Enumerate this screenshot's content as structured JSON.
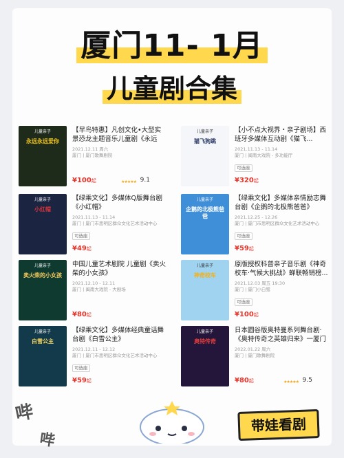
{
  "header": {
    "title_line1": "厦门11- 1月",
    "title_line2": "儿童剧合集"
  },
  "items": [
    {
      "title": "【早鸟特惠】凡创文化•大型实景恐龙主题音乐儿童剧《永远永...",
      "date": "2021.12.11 周六",
      "venue": "厦门 | 厦门歌舞剧院",
      "badge": "",
      "price": "¥100",
      "unit": "起",
      "rating": "9.1",
      "stars": "★★★★★",
      "poster_tag": "儿童亲子",
      "poster_text": "永远永远爱你",
      "poster_color": "#1e2a1a",
      "poster_accent": "#f2c318"
    },
    {
      "title": "【小不点大视界・亲子剧场】西班牙多媒体互动剧《猫飞...",
      "date": "2021.11.13 - 11.14",
      "venue": "厦门 | 闽南大戏院 - 多功能厅",
      "badge": "可选座",
      "price": "¥320",
      "unit": "起",
      "rating": "",
      "stars": "",
      "poster_tag": "儿童亲子",
      "poster_text": "猫飞狗跳",
      "poster_color": "#f4f6fa",
      "poster_accent": "#2b3a66"
    },
    {
      "title": "【绿乘文化】多媒体Q版舞台剧《小红帽》",
      "date": "2021.11.13 - 11.14",
      "venue": "厦门 | 厦门市思明区群众文化艺术活动中心",
      "badge": "可选座",
      "price": "¥49",
      "unit": "起",
      "rating": "",
      "stars": "",
      "poster_tag": "儿童亲子",
      "poster_text": "小红帽",
      "poster_color": "#1b2440",
      "poster_accent": "#d6333a"
    },
    {
      "title": "【绿乘文化】多媒体亲情励志舞台剧《企鹅的北极熊爸爸》",
      "date": "2021.12.25 - 12.26",
      "venue": "厦门 | 厦门市思明区群众文化艺术活动中心",
      "badge": "可选座",
      "price": "¥59",
      "unit": "起",
      "rating": "",
      "stars": "",
      "poster_tag": "儿童亲子",
      "poster_text": "企鹅的北极熊爸爸",
      "poster_color": "#3f8fd8",
      "poster_accent": "#ffffff"
    },
    {
      "title": "中国儿童艺术剧院 儿童剧《卖火柴的小女孩》",
      "date": "2021.12.10 - 12.11",
      "venue": "厦门 | 闽南大戏院 - 大剧场",
      "badge": "",
      "price": "¥80",
      "unit": "起",
      "rating": "",
      "stars": "",
      "poster_tag": "儿童亲子",
      "poster_text": "卖火柴的小女孩",
      "poster_color": "#0f3a30",
      "poster_accent": "#f1c85a"
    },
    {
      "title": "原版授权科普亲子音乐剧《神奇校车·气候大挑战》蝉联畅销榜...",
      "date": "2021.12.03 周五 19:30",
      "venue": "厦门 | 厦门小白鹭",
      "badge": "可选座",
      "price": "¥100",
      "unit": "起",
      "rating": "",
      "stars": "",
      "poster_tag": "儿童亲子",
      "poster_text": "神奇校车",
      "poster_color": "#9fd3ef",
      "poster_accent": "#f3b21a"
    },
    {
      "title": "【绿乘文化】多媒体经典童话舞台剧《白雪公主》",
      "date": "2021.12.11 - 12.12",
      "venue": "厦门 | 厦门市思明区群众文化艺术活动中心",
      "badge": "可选座",
      "price": "¥59",
      "unit": "起",
      "rating": "",
      "stars": "",
      "poster_tag": "儿童亲子",
      "poster_text": "白雪公主",
      "poster_color": "#133a4a",
      "poster_accent": "#f7d45a"
    },
    {
      "title": "日本圆谷版奥特曼系列舞台剧·《奥特传奇之英雄归来》一厦门",
      "date": "2022.01.22 周六",
      "venue": "厦门 | 厦门歌舞剧院",
      "badge": "",
      "price": "¥80",
      "unit": "起",
      "rating": "9.5",
      "stars": "★★★★★",
      "poster_tag": "儿童亲子",
      "poster_text": "奥特传奇",
      "poster_color": "#24153a",
      "poster_accent": "#e33b3b"
    }
  ],
  "footer": {
    "cta": "带娃看剧",
    "doodle1": "哔",
    "doodle2": "哔"
  },
  "colors": {
    "accent": "#ffd84d",
    "price": "#e5352b"
  }
}
